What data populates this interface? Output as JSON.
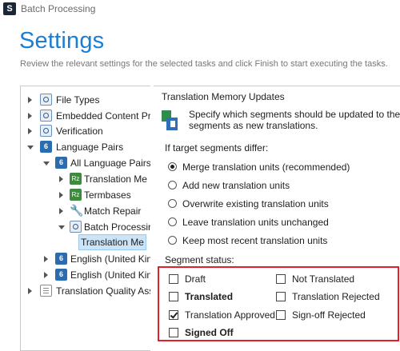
{
  "window": {
    "title": "Batch Processing",
    "icon_letter": "S"
  },
  "header": {
    "title": "Settings",
    "description": "Review the relevant settings for the selected tasks and click Finish to start executing the tasks."
  },
  "tree": {
    "items": [
      {
        "label": "File Types",
        "icon": "gear-icon",
        "expanded": false
      },
      {
        "label": "Embedded Content Pro",
        "icon": "gear-icon",
        "expanded": false
      },
      {
        "label": "Verification",
        "icon": "gear-icon",
        "expanded": false
      },
      {
        "label": "Language Pairs",
        "icon": "blue-settings-icon",
        "expanded": true
      },
      {
        "label": "All Language Pairs",
        "icon": "blue-settings-icon",
        "expanded": true
      },
      {
        "label": "Translation Me",
        "icon": "tm-icon",
        "expanded": false
      },
      {
        "label": "Termbases",
        "icon": "termbase-icon",
        "expanded": false
      },
      {
        "label": "Match Repair",
        "icon": "wrench-icon",
        "expanded": false
      },
      {
        "label": "Batch Processin",
        "icon": "gear-icon",
        "expanded": true
      },
      {
        "label": "Translation Me",
        "icon": "none",
        "selected": true
      },
      {
        "label": "English (United Kin",
        "icon": "blue-settings-icon",
        "expanded": false
      },
      {
        "label": "English (United Kin",
        "icon": "blue-settings-icon",
        "expanded": false
      },
      {
        "label": "Translation Quality Asse",
        "icon": "document-icon",
        "expanded": false
      }
    ]
  },
  "panel": {
    "section_title": "Translation Memory Updates",
    "description_line1": "Specify which segments should be updated to the",
    "description_line2": "segments as new translations.",
    "differ_label": "If target segments differ:",
    "radios": [
      {
        "label": "Merge translation units (recommended)",
        "selected": true
      },
      {
        "label": "Add new translation units",
        "selected": false
      },
      {
        "label": "Overwrite existing translation units",
        "selected": false
      },
      {
        "label": "Leave translation units unchanged",
        "selected": false
      },
      {
        "label": "Keep most recent translation units",
        "selected": false
      }
    ],
    "segment_status_label": "Segment status:",
    "statuses": {
      "draft": {
        "label": "Draft",
        "checked": false
      },
      "translated": {
        "label": "Translated",
        "checked": false
      },
      "translation_approved": {
        "label": "Translation Approved",
        "checked": true
      },
      "signed_off": {
        "label": "Signed Off",
        "checked": false
      },
      "not_translated": {
        "label": "Not Translated",
        "checked": false
      },
      "translation_rejected": {
        "label": "Translation Rejected",
        "checked": false
      },
      "signoff_rejected": {
        "label": "Sign-off Rejected",
        "checked": false
      }
    }
  },
  "colors": {
    "accent": "#1a7fd4",
    "highlight": "#e1202a",
    "selection": "#cce4f7"
  }
}
